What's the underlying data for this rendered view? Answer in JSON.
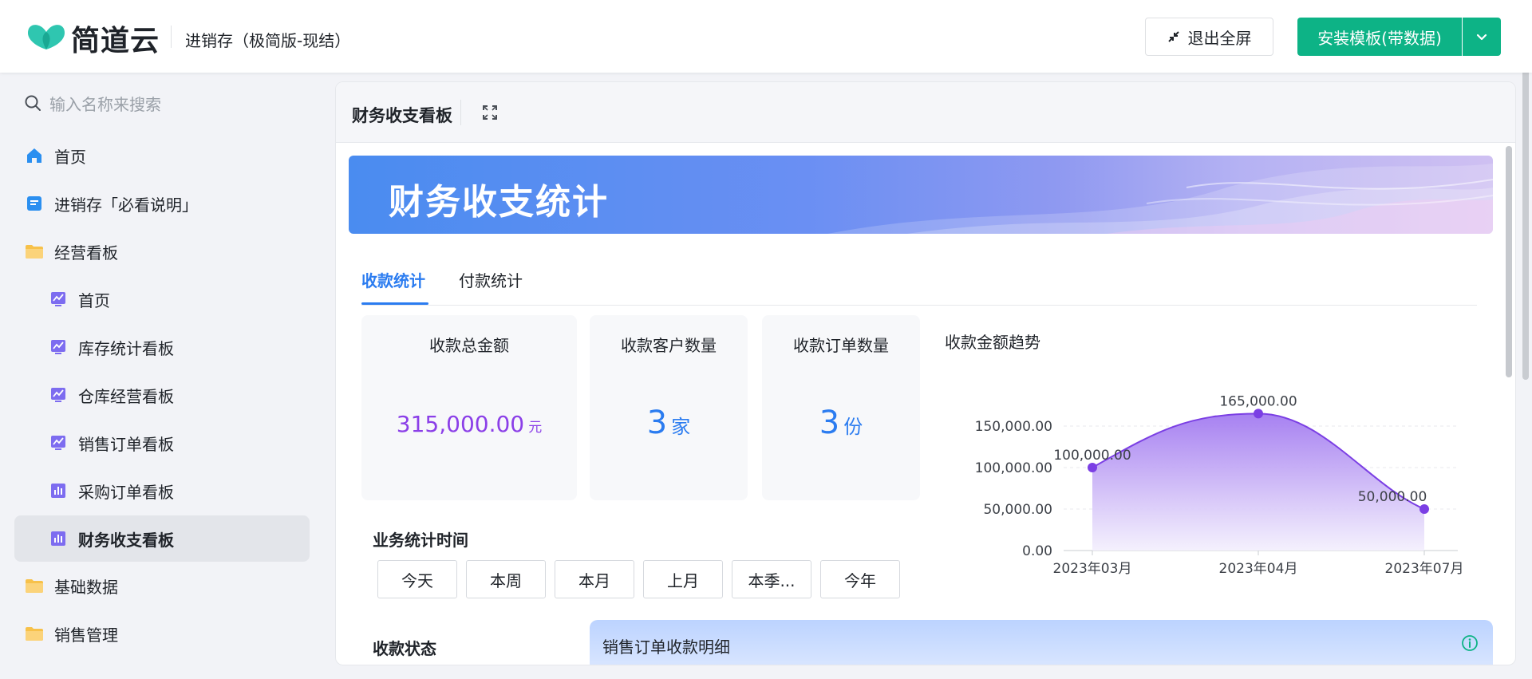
{
  "header": {
    "brand": "简道云",
    "app_title": "进销存（极简版-现结）",
    "exit_fullscreen": "退出全屏",
    "install_button": "安装模板(带数据)"
  },
  "sidebar": {
    "search_placeholder": "输入名称来搜索",
    "items": [
      {
        "label": "首页",
        "icon": "home-icon",
        "level": 0,
        "active": false
      },
      {
        "label": "进销存「必看说明」",
        "icon": "document-icon",
        "level": 0,
        "active": false
      },
      {
        "label": "经营看板",
        "icon": "folder-icon",
        "level": 0,
        "active": false
      },
      {
        "label": "首页",
        "icon": "dashboard-line-icon",
        "level": 1,
        "active": false
      },
      {
        "label": "库存统计看板",
        "icon": "dashboard-line-icon",
        "level": 1,
        "active": false
      },
      {
        "label": "仓库经营看板",
        "icon": "dashboard-line-icon",
        "level": 1,
        "active": false
      },
      {
        "label": "销售订单看板",
        "icon": "dashboard-line-icon",
        "level": 1,
        "active": false
      },
      {
        "label": "采购订单看板",
        "icon": "dashboard-bar-icon",
        "level": 1,
        "active": false
      },
      {
        "label": "财务收支看板",
        "icon": "dashboard-bar-icon",
        "level": 1,
        "active": true
      },
      {
        "label": "基础数据",
        "icon": "folder-icon",
        "level": 0,
        "active": false
      },
      {
        "label": "销售管理",
        "icon": "folder-icon",
        "level": 0,
        "active": false
      }
    ]
  },
  "panel": {
    "title": "财务收支看板",
    "banner_title": "财务收支统计",
    "tabs": [
      "收款统计",
      "付款统计"
    ],
    "active_tab": 0,
    "cards": [
      {
        "label": "收款总金额",
        "value": "315,000.00",
        "unit": "元"
      },
      {
        "label": "收款客户数量",
        "value": "3",
        "unit": "家"
      },
      {
        "label": "收款订单数量",
        "value": "3",
        "unit": "份"
      }
    ],
    "trend_title": "收款金额趋势",
    "biz_time_title": "业务统计时间",
    "time_buttons": [
      "今天",
      "本周",
      "本月",
      "上月",
      "本季...",
      "今年"
    ],
    "status_title": "收款状态",
    "detail_title": "销售订单收款明细"
  },
  "chart_data": {
    "type": "area",
    "title": "收款金额趋势",
    "categories": [
      "2023年03月",
      "2023年04月",
      "2023年07月"
    ],
    "values": [
      100000,
      165000,
      50000
    ],
    "value_labels": [
      "100,000.00",
      "165,000.00",
      "50,000.00"
    ],
    "y_ticks": [
      "0.00",
      "50,000.00",
      "100,000.00",
      "150,000.00"
    ],
    "ylim": [
      0,
      150000
    ],
    "grid": true,
    "colors": {
      "line": "#7b3fe4",
      "fill_top": "#a27af0",
      "fill_bottom": "#f3effd"
    }
  },
  "colors": {
    "accent_blue": "#2b7cf0",
    "accent_green": "#0db386",
    "purple_value": "#8b3fe8"
  }
}
